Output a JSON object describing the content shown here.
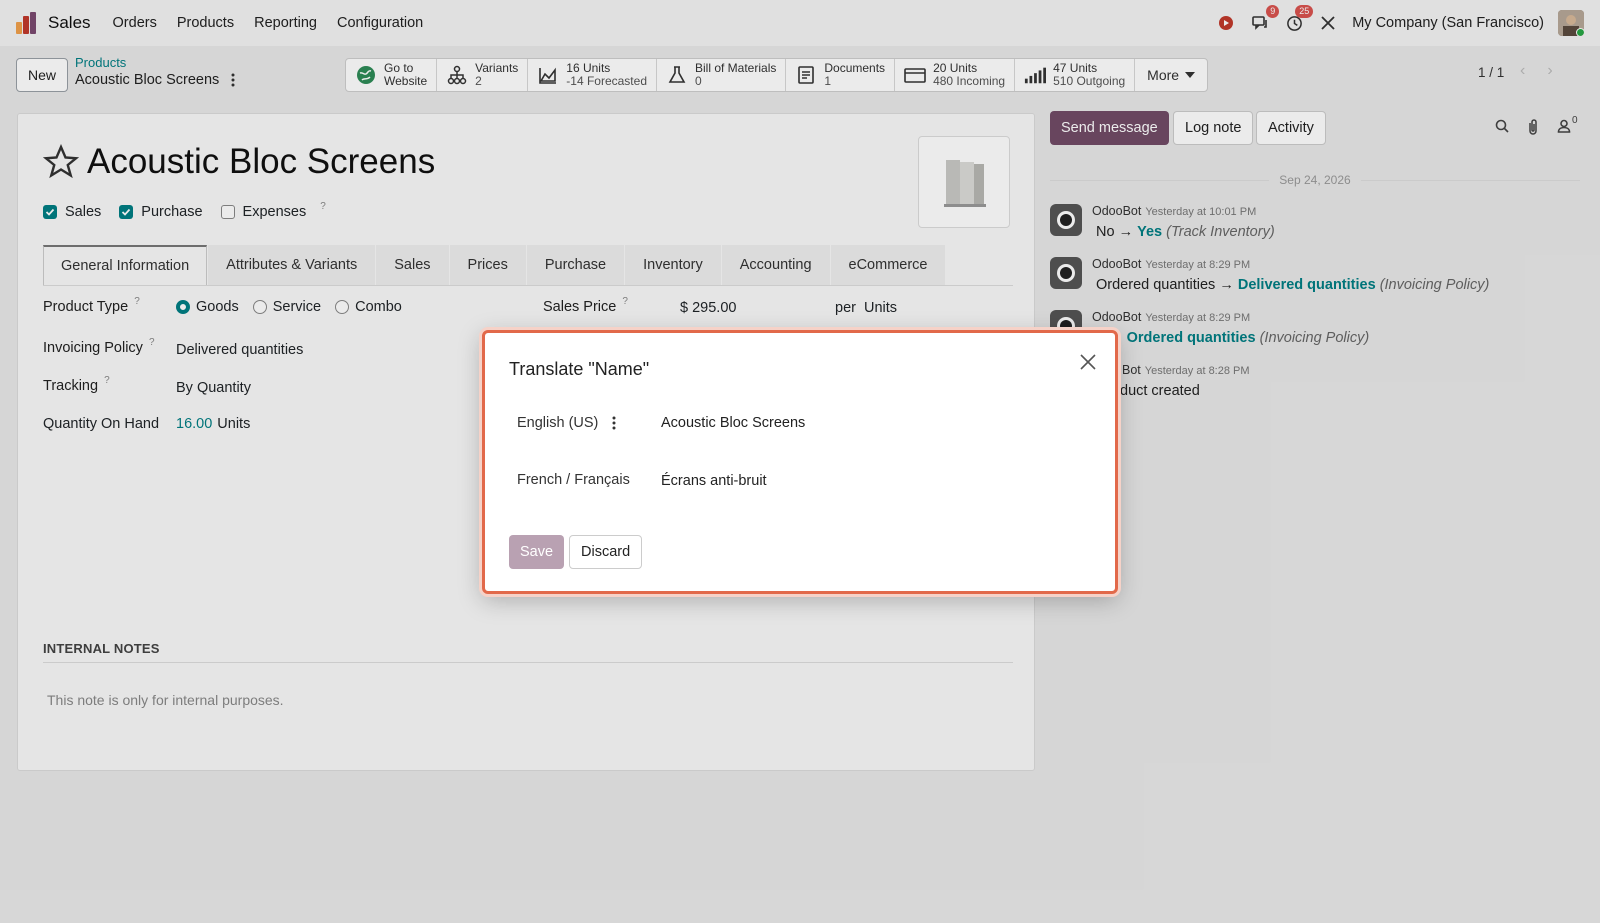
{
  "navbar": {
    "app_title": "Sales",
    "menu": [
      "Orders",
      "Products",
      "Reporting",
      "Configuration"
    ],
    "messages_badge": "9",
    "activities_badge": "25",
    "company": "My Company (San Francisco)"
  },
  "control_panel": {
    "new_label": "New",
    "breadcrumb_parent": "Products",
    "breadcrumb_current": "Acoustic Bloc Screens",
    "pager": "1 / 1",
    "smart_buttons": [
      {
        "line1": "Go to",
        "line2": "Website",
        "icon": "globe-icon"
      },
      {
        "line1": "Variants",
        "line2": "2",
        "icon": "sitemap-icon"
      },
      {
        "line1": "16 Units",
        "line2": "-14 Forecasted",
        "icon": "area-chart-icon"
      },
      {
        "line1": "Bill of Materials",
        "line2": "0",
        "icon": "flask-icon"
      },
      {
        "line1": "Documents",
        "line2": "1",
        "icon": "document-icon"
      },
      {
        "line1": "20 Units",
        "line2": "480 Incoming",
        "icon": "credit-card-icon"
      },
      {
        "line1": "47 Units",
        "line2": "510 Outgoing",
        "icon": "signal-bars-icon"
      }
    ],
    "more_label": "More"
  },
  "form": {
    "product_name": "Acoustic Bloc Screens",
    "checkboxes": {
      "sales": "Sales",
      "purchase": "Purchase",
      "expenses": "Expenses"
    },
    "help_mark": "?",
    "tabs": [
      "General Information",
      "Attributes & Variants",
      "Sales",
      "Prices",
      "Purchase",
      "Inventory",
      "Accounting",
      "eCommerce"
    ],
    "product_type_label": "Product Type",
    "product_type_options": [
      "Goods",
      "Service",
      "Combo"
    ],
    "invoicing_policy_label": "Invoicing Policy",
    "invoicing_policy_value": "Delivered quantities",
    "tracking_label": "Tracking",
    "tracking_value": "By Quantity",
    "qty_label": "Quantity On Hand",
    "qty_value": "16.00",
    "qty_unit": "Units",
    "sales_price_label": "Sales Price",
    "sales_price_value": "$ 295.00",
    "per_label": "per",
    "per_unit": "Units",
    "internal_notes_title": "INTERNAL NOTES",
    "internal_notes_placeholder": "This note is only for internal purposes."
  },
  "chatter": {
    "send_message": "Send message",
    "log_note": "Log note",
    "activity": "Activity",
    "followers_count": "0",
    "date": "Sep 24, 2026",
    "messages": [
      {
        "author": "OdooBot",
        "time": "Yesterday at 10:01 PM",
        "old": "No",
        "arrow": "→",
        "new": "Yes",
        "field": "(Track Inventory)"
      },
      {
        "author": "OdooBot",
        "time": "Yesterday at 8:29 PM",
        "old": "Ordered quantities",
        "arrow": "→",
        "new": "Delivered quantities",
        "field": "(Invoicing Policy)"
      },
      {
        "author": "OdooBot",
        "time": "Yesterday at 8:29 PM",
        "old": "e",
        "arrow": "→",
        "new": "Ordered quantities",
        "field": "(Invoicing Policy)"
      },
      {
        "author": "Bot",
        "time": "Yesterday at 8:28 PM",
        "text": "duct created"
      }
    ]
  },
  "dialog": {
    "title": "Translate \"Name\"",
    "rows": [
      {
        "lang": "English (US)",
        "value": "Acoustic Bloc Screens"
      },
      {
        "lang": "French / Français",
        "value": "Écrans anti-bruit"
      }
    ],
    "save_label": "Save",
    "discard_label": "Discard"
  },
  "colors": {
    "primary": "#714b67",
    "link": "#017e84",
    "dialog_border": "#e2694a"
  }
}
